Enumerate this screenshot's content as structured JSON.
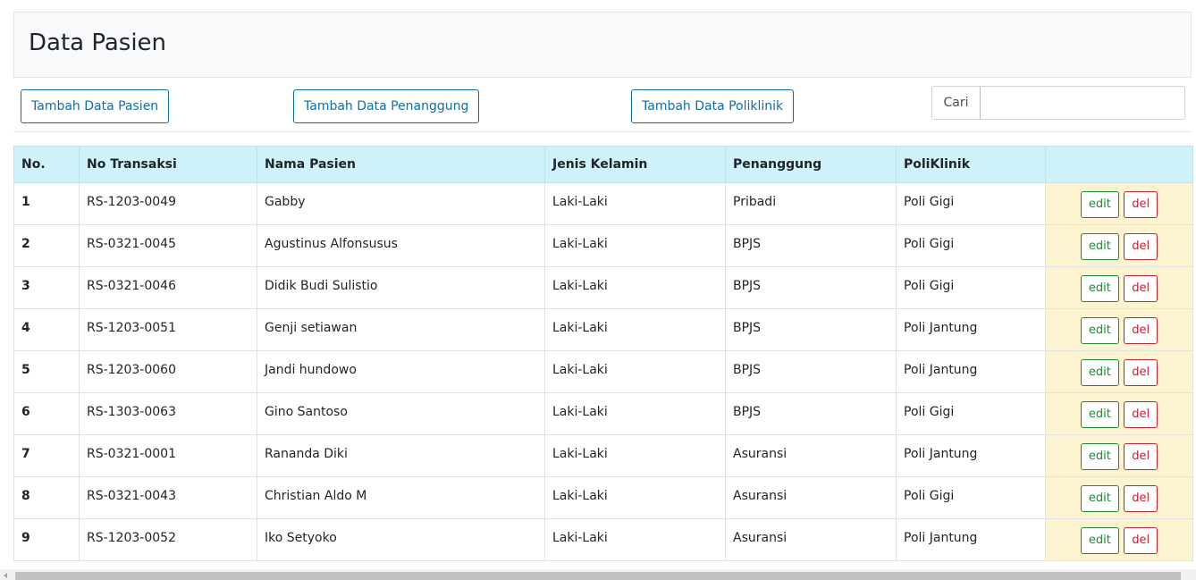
{
  "page": {
    "title": "Data Pasien"
  },
  "toolbar": {
    "add_patient": "Tambah Data Pasien",
    "add_guarantor": "Tambah Data Penanggung",
    "add_clinic": "Tambah Data Poliklinik",
    "search_label": "Cari",
    "search_value": ""
  },
  "table": {
    "headers": [
      "No.",
      "No Transaksi",
      "Nama Pasien",
      "Jenis Kelamin",
      "Penanggung",
      "PoliKlinik",
      ""
    ],
    "edit_label": "edit",
    "del_label": "del",
    "rows": [
      {
        "no": "1",
        "trx": "RS-1203-0049",
        "name": "Gabby",
        "gender": "Laki-Laki",
        "guarantor": "Pribadi",
        "clinic": "Poli Gigi"
      },
      {
        "no": "2",
        "trx": "RS-0321-0045",
        "name": "Agustinus Alfonsusus",
        "gender": "Laki-Laki",
        "guarantor": "BPJS",
        "clinic": "Poli Gigi"
      },
      {
        "no": "3",
        "trx": "RS-0321-0046",
        "name": "Didik Budi Sulistio",
        "gender": "Laki-Laki",
        "guarantor": "BPJS",
        "clinic": "Poli Gigi"
      },
      {
        "no": "4",
        "trx": "RS-1203-0051",
        "name": "Genji setiawan",
        "gender": "Laki-Laki",
        "guarantor": "BPJS",
        "clinic": "Poli Jantung"
      },
      {
        "no": "5",
        "trx": "RS-1203-0060",
        "name": "Jandi hundowo",
        "gender": "Laki-Laki",
        "guarantor": "BPJS",
        "clinic": "Poli Jantung"
      },
      {
        "no": "6",
        "trx": "RS-1303-0063",
        "name": "Gino Santoso",
        "gender": "Laki-Laki",
        "guarantor": "BPJS",
        "clinic": "Poli Gigi"
      },
      {
        "no": "7",
        "trx": "RS-0321-0001",
        "name": "Rananda Diki",
        "gender": "Laki-Laki",
        "guarantor": "Asuransi",
        "clinic": "Poli Jantung"
      },
      {
        "no": "8",
        "trx": "RS-0321-0043",
        "name": "Christian Aldo M",
        "gender": "Laki-Laki",
        "guarantor": "Asuransi",
        "clinic": "Poli Gigi"
      },
      {
        "no": "9",
        "trx": "RS-1203-0052",
        "name": "Iko Setyoko",
        "gender": "Laki-Laki",
        "guarantor": "Asuransi",
        "clinic": "Poli Jantung"
      }
    ]
  },
  "colors": {
    "header_bg": "#cff1f9",
    "action_bg": "#fdf3cf",
    "primary": "#0f6fa8",
    "success": "#218838",
    "danger": "#c82333"
  }
}
